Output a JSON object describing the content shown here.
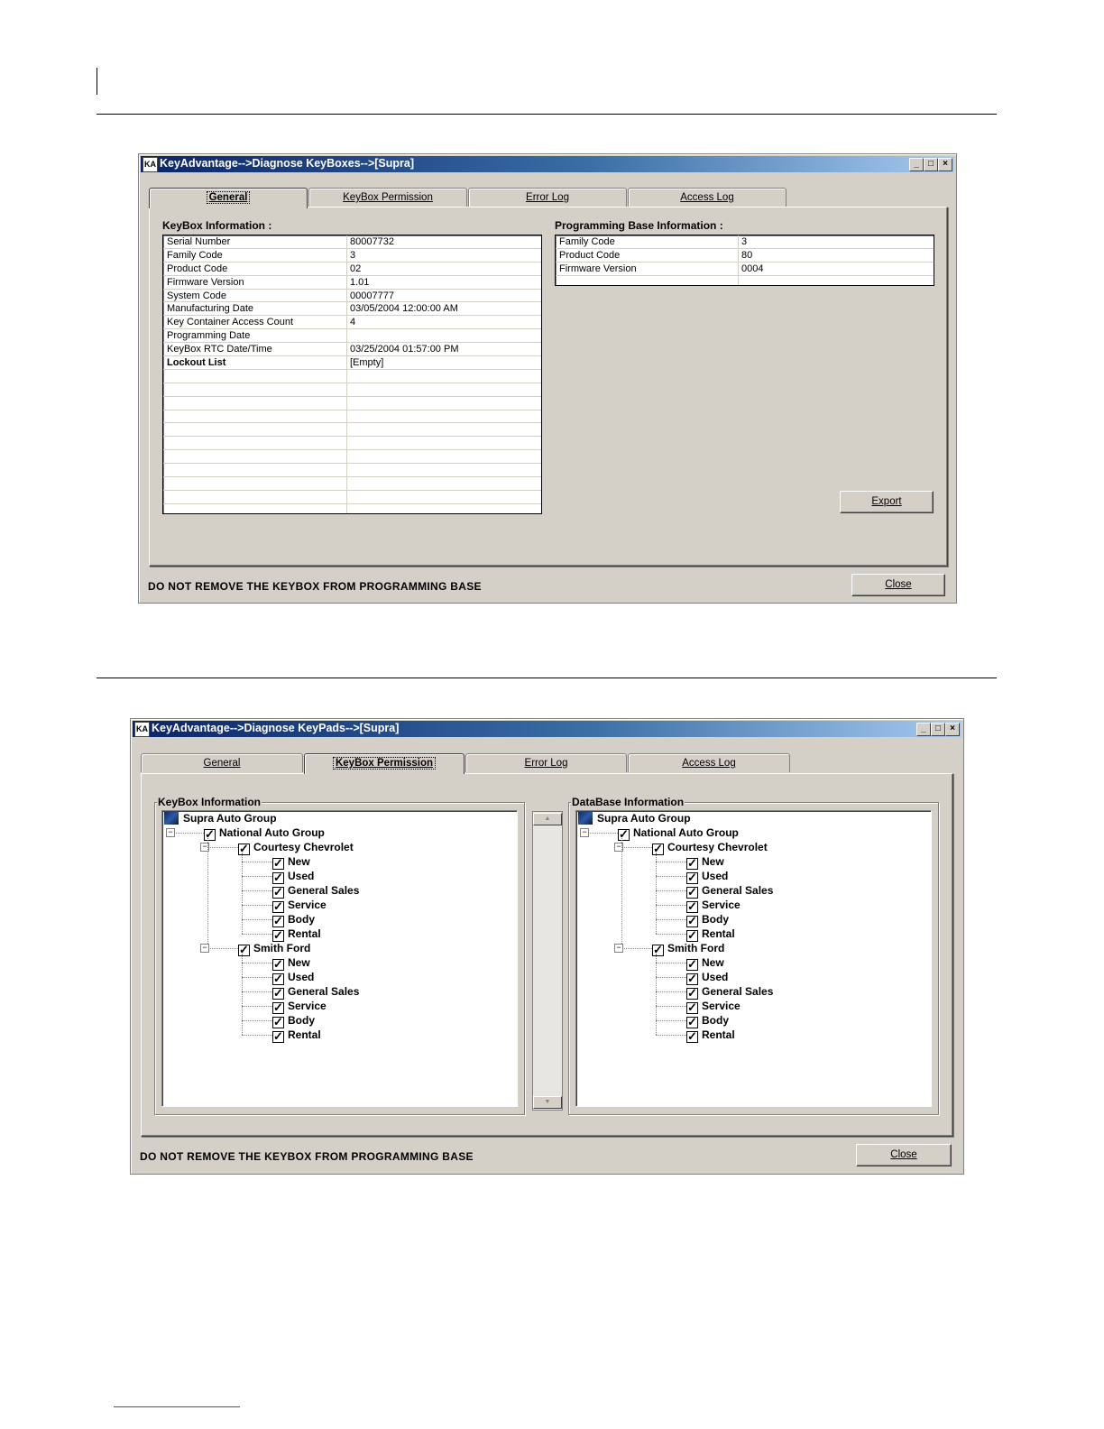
{
  "screen1": {
    "title": "KeyAdvantage-->Diagnose KeyBoxes-->[Supra]",
    "tabs": [
      "General",
      "KeyBox Permission",
      "Error Log",
      "Access Log"
    ],
    "active_tab": "General",
    "keybox_label": "KeyBox Information :",
    "keybox_rows": [
      {
        "label": "Serial Number",
        "value": "80007732"
      },
      {
        "label": "Family Code",
        "value": "3"
      },
      {
        "label": "Product Code",
        "value": "02"
      },
      {
        "label": "Firmware Version",
        "value": "1.01"
      },
      {
        "label": "System Code",
        "value": "00007777"
      },
      {
        "label": "Manufacturing Date",
        "value": "03/05/2004 12:00:00 AM"
      },
      {
        "label": "Key Container Access Count",
        "value": "4"
      },
      {
        "label": "Programming Date",
        "value": ""
      },
      {
        "label": "KeyBox RTC Date/Time",
        "value": "03/25/2004 01:57:00 PM"
      },
      {
        "label": "Lockout List",
        "value": "[Empty]"
      }
    ],
    "base_label": "Programming Base  Information :",
    "base_rows": [
      {
        "label": "Family Code",
        "value": "3"
      },
      {
        "label": "Product Code",
        "value": "80"
      },
      {
        "label": "Firmware Version",
        "value": "0004"
      }
    ],
    "export_label": "Export",
    "status": "DO NOT REMOVE THE KEYBOX FROM PROGRAMMING BASE",
    "close_label": "Close"
  },
  "screen2": {
    "title": "KeyAdvantage-->Diagnose KeyPads-->[Supra]",
    "tabs": [
      "General",
      "KeyBox Permission",
      "Error Log",
      "Access Log"
    ],
    "active_tab": "KeyBox Permission",
    "left_group": "KeyBox Information",
    "right_group": "DataBase Information",
    "tree": {
      "root": "Supra Auto Group",
      "group": "National Auto Group",
      "dealers": [
        {
          "name": "Courtesy Chevrolet",
          "departments": [
            "New",
            "Used",
            "General Sales",
            "Service",
            "Body",
            "Rental"
          ]
        },
        {
          "name": "Smith Ford",
          "departments": [
            "New",
            "Used",
            "General Sales",
            "Service",
            "Body",
            "Rental"
          ]
        }
      ]
    },
    "status": "DO NOT REMOVE THE KEYBOX FROM PROGRAMMING BASE",
    "close_label": "Close"
  },
  "icons": {
    "check": "✓",
    "collapse": "−",
    "minimize": "_",
    "maximize": "□",
    "close": "×"
  }
}
